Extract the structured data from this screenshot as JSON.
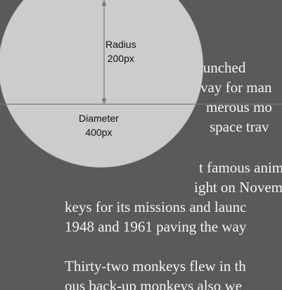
{
  "article": {
    "paragraph1": {
      "line1": "re launched",
      "line2": "vay for man",
      "line3": "merous mo",
      "line4": "space trav"
    },
    "paragraph2": {
      "line1": "t famous anim",
      "line2": "ight on Novembe",
      "line3": "keys for its missions and launc",
      "line4": "1948 and 1961 paving the way"
    },
    "paragraph3": {
      "line1": "Thirty-two monkeys flew in th",
      "line2": "ous back-up monkeys also we"
    }
  },
  "overlay": {
    "radius_label": "Radius",
    "radius_value": "200px",
    "diameter_label": "Diameter",
    "diameter_value": "400px"
  },
  "colors": {
    "background": "#5a5a5a",
    "circle_fill": "#cccccc",
    "line_color": "#777777",
    "text_light": "#f4f4f4",
    "text_dark": "#111111"
  }
}
